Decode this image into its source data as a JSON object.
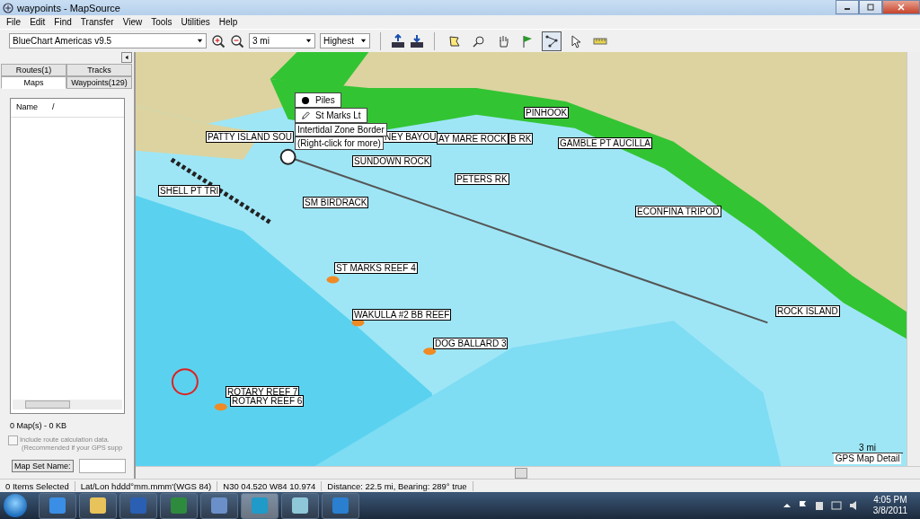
{
  "window": {
    "title": "waypoints - MapSource"
  },
  "menu": [
    "File",
    "Edit",
    "Find",
    "Transfer",
    "View",
    "Tools",
    "Utilities",
    "Help"
  ],
  "toolbar": {
    "map_product": "BlueChart Americas v9.5",
    "zoom_scale": "3 mi",
    "detail": "Highest",
    "tools": [
      {
        "kind": "map-select",
        "selected": false
      },
      {
        "kind": "zoom",
        "selected": false
      },
      {
        "kind": "hand",
        "selected": false
      },
      {
        "kind": "flag",
        "selected": false
      },
      {
        "kind": "route",
        "selected": true
      },
      {
        "kind": "pointer",
        "selected": false
      },
      {
        "kind": "ruler",
        "selected": false
      }
    ]
  },
  "sidebar": {
    "tabs": [
      {
        "label": "Routes(1)",
        "selected": false
      },
      {
        "label": "Tracks",
        "selected": false
      },
      {
        "label": "Maps",
        "selected": true
      },
      {
        "label": "Waypoints(129)",
        "selected": false
      }
    ],
    "list_columns": [
      "Name",
      "/"
    ],
    "summary": "0 Map(s) - 0 KB",
    "include_route_data": {
      "label": "Include route calculation data.",
      "note": "(Recommended if your GPS supp",
      "checked": false
    },
    "map_set_button": "Map Set Name:"
  },
  "map": {
    "popup": [
      {
        "kind": "dot",
        "label": "Piles"
      },
      {
        "kind": "pencil",
        "label": "St Marks Lt"
      },
      {
        "kind": "text",
        "label": "Intertidal Zone Border"
      },
      {
        "kind": "text",
        "label": "(Right-click for more)"
      }
    ],
    "waypoints": [
      "PINHOOK",
      "PATTY ISLAND SOU",
      "NEY BAYOU",
      "AY MARE ROCK",
      "B RK",
      "GAMBLE PT AUCILLA",
      "SUNDOWN ROCK",
      "PETERS RK",
      "SHELL PT TRI",
      "SM BIRDRACK",
      "ECONFINA TRIPOD",
      "ST MARKS REEF 4",
      "ROCK ISLAND",
      "WAKULLA #2 BB REEF",
      "DOG BALLARD 3",
      "ROTARY REEF 7",
      "ROTARY REEF 6"
    ],
    "scale": "3 mi",
    "detail_label": "GPS Map Detail"
  },
  "status_bar": [
    "0 Items Selected",
    "Lat/Lon hddd°mm.mmm'(WGS 84)",
    "N30 04.520 W84 10.974",
    "Distance: 22.5 mi, Bearing: 289° true"
  ],
  "taskbar": {
    "apps": [
      {
        "kind": "browser",
        "active": false
      },
      {
        "kind": "folder",
        "active": false
      },
      {
        "kind": "word",
        "active": false
      },
      {
        "kind": "excel",
        "active": false
      },
      {
        "kind": "panel",
        "active": false
      },
      {
        "kind": "globe",
        "active": true
      },
      {
        "kind": "doc",
        "active": false
      },
      {
        "kind": "sail",
        "active": false
      }
    ],
    "time": "4:05 PM",
    "date": "3/8/2011"
  }
}
